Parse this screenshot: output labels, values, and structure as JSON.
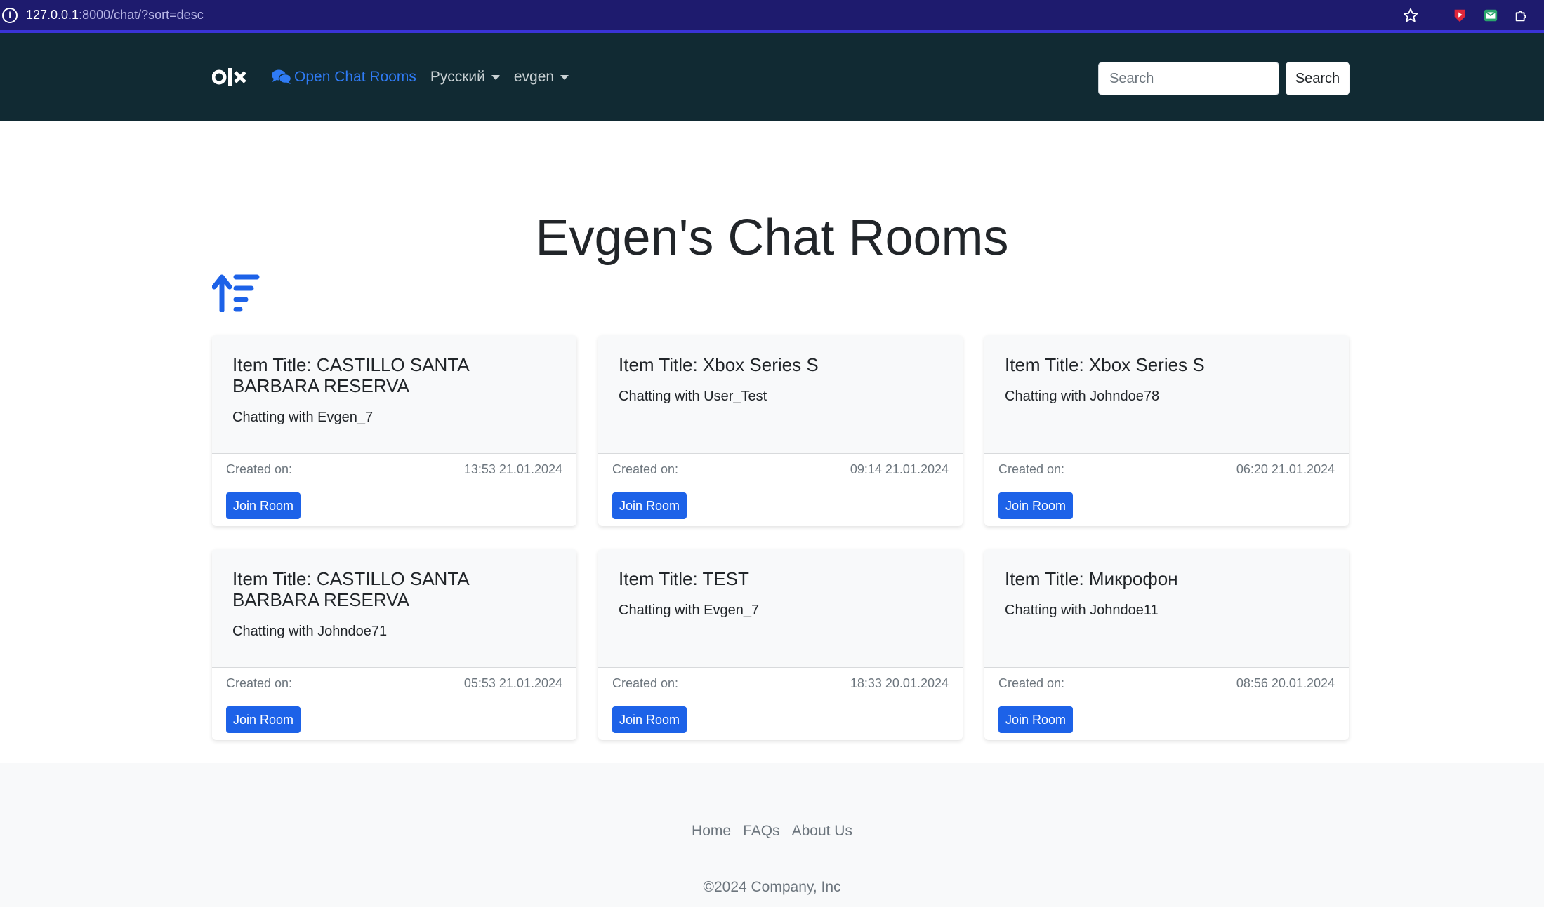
{
  "browser": {
    "url_host": "127.0.0.1",
    "url_rest": ":8000/chat/?sort=desc"
  },
  "navbar": {
    "open_chat_rooms": "Open Chat Rooms",
    "language": "Русский",
    "user": "evgen",
    "search_placeholder": "Search",
    "search_button": "Search"
  },
  "page": {
    "title": "Evgen's Chat Rooms"
  },
  "rooms": [
    {
      "title": "Item Title: CASTILLO SANTA BARBARA RESERVA",
      "chatting": "Chatting with Evgen_7",
      "created_label": "Created on:",
      "created": "13:53 21.01.2024",
      "join": "Join Room"
    },
    {
      "title": "Item Title: Xbox Series S",
      "chatting": "Chatting with User_Test",
      "created_label": "Created on:",
      "created": "09:14 21.01.2024",
      "join": "Join Room"
    },
    {
      "title": "Item Title: Xbox Series S",
      "chatting": "Chatting with Johndoe78",
      "created_label": "Created on:",
      "created": "06:20 21.01.2024",
      "join": "Join Room"
    },
    {
      "title": "Item Title: CASTILLO SANTA BARBARA RESERVA",
      "chatting": "Chatting with Johndoe71",
      "created_label": "Created on:",
      "created": "05:53 21.01.2024",
      "join": "Join Room"
    },
    {
      "title": "Item Title: TEST",
      "chatting": "Chatting with Evgen_7",
      "created_label": "Created on:",
      "created": "18:33 20.01.2024",
      "join": "Join Room"
    },
    {
      "title": "Item Title: Микрофон",
      "chatting": "Chatting with Johndoe11",
      "created_label": "Created on:",
      "created": "08:56 20.01.2024",
      "join": "Join Room"
    }
  ],
  "footer": {
    "links": [
      "Home",
      "FAQs",
      "About Us"
    ],
    "copyright": "©2024 Company, Inc"
  },
  "colors": {
    "browser_bar": "#1e1b6e",
    "navbar": "#112a33",
    "accent": "#1d62e8",
    "link_active": "#2f7bf5"
  }
}
